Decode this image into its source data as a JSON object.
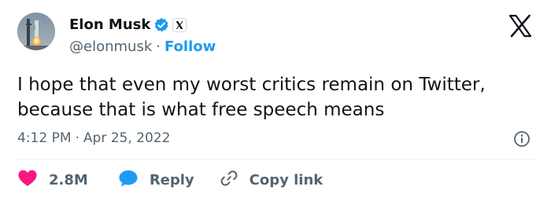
{
  "author": {
    "display_name": "Elon Musk",
    "handle": "@elonmusk",
    "separator": "·",
    "follow_label": "Follow",
    "verified_color": "#1d9bf0"
  },
  "tweet": {
    "text": "I hope that even my worst critics remain on Twitter, because that is what free speech means",
    "time": "4:12 PM",
    "separator": "·",
    "date": "Apr 25, 2022"
  },
  "actions": {
    "likes_count": "2.8M",
    "reply_label": "Reply",
    "copy_link_label": "Copy link"
  },
  "icons": {
    "logo": "x-logo-icon",
    "verified": "verified-badge-icon",
    "affiliate": "x-affiliate-badge-icon",
    "info": "info-icon",
    "like": "heart-icon",
    "reply": "speech-bubble-icon",
    "copy_link": "link-icon"
  },
  "colors": {
    "link": "#1d9bf0",
    "like": "#f91880",
    "text": "#0f1419",
    "muted": "#536471"
  }
}
